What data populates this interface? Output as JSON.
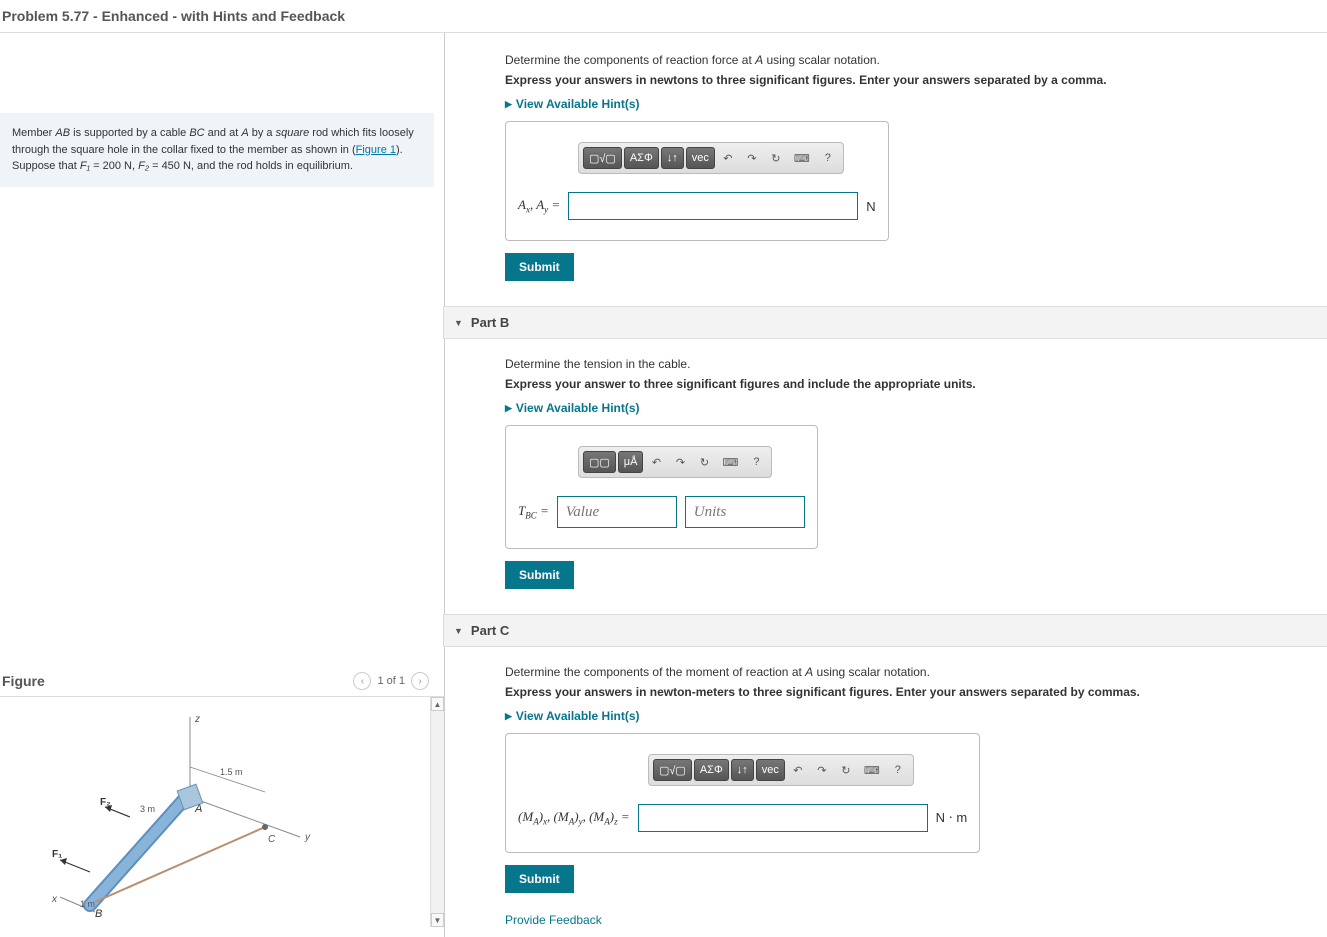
{
  "header": {
    "title": "Problem 5.77 - Enhanced - with Hints and Feedback"
  },
  "problem": {
    "pre1": "Member ",
    "var1": "AB",
    "mid1": " is supported by a cable ",
    "var2": "BC",
    "mid2": " and at ",
    "var3": "A",
    "mid3": " by a ",
    "emph1": "square",
    "mid4": " rod which fits loosely through the square hole in the collar fixed to the member as shown in (",
    "figlink": "Figure 1",
    "mid5": "). Suppose that ",
    "f1var": "F₁",
    "f1val": " = 200 N, ",
    "f2var": "F₂",
    "f2val": " = 450 N, and the rod holds in equilibrium."
  },
  "figure": {
    "title": "Figure",
    "count": "1 of 1"
  },
  "partA": {
    "instr": "Determine the components of reaction force at A using scalar notation.",
    "instrBold": "Express your answers in newtons to three significant figures. Enter your answers separated by a comma.",
    "hints": "View Available Hint(s)",
    "varLabel": "Aₓ, Aᵧ =",
    "unit": "N",
    "submit": "Submit"
  },
  "partB": {
    "title": "Part B",
    "instr": "Determine the tension in the cable.",
    "instrBold": "Express your answer to three significant figures and include the appropriate units.",
    "hints": "View Available Hint(s)",
    "varLabel": "T_BC =",
    "valuePlaceholder": "Value",
    "unitsPlaceholder": "Units",
    "submit": "Submit"
  },
  "partC": {
    "title": "Part C",
    "instr": "Determine the components of the moment of reaction at A using scalar notation.",
    "instrBold": "Express your answers in newton-meters to three significant figures. Enter your answers separated by commas.",
    "hints": "View Available Hint(s)",
    "varLabel": "(M_A)ₓ, (M_A)ᵧ, (M_A)_z =",
    "unit": "N ⋅ m",
    "submit": "Submit"
  },
  "toolbar": {
    "templates": "▢√▢",
    "greek": "ΑΣΦ",
    "updown": "↓↑",
    "vec": "vec",
    "undo": "↶",
    "redo": "↷",
    "reset": "↻",
    "keyboard": "⌨",
    "help": "?",
    "mu": "μÅ"
  },
  "feedback": "Provide Feedback"
}
